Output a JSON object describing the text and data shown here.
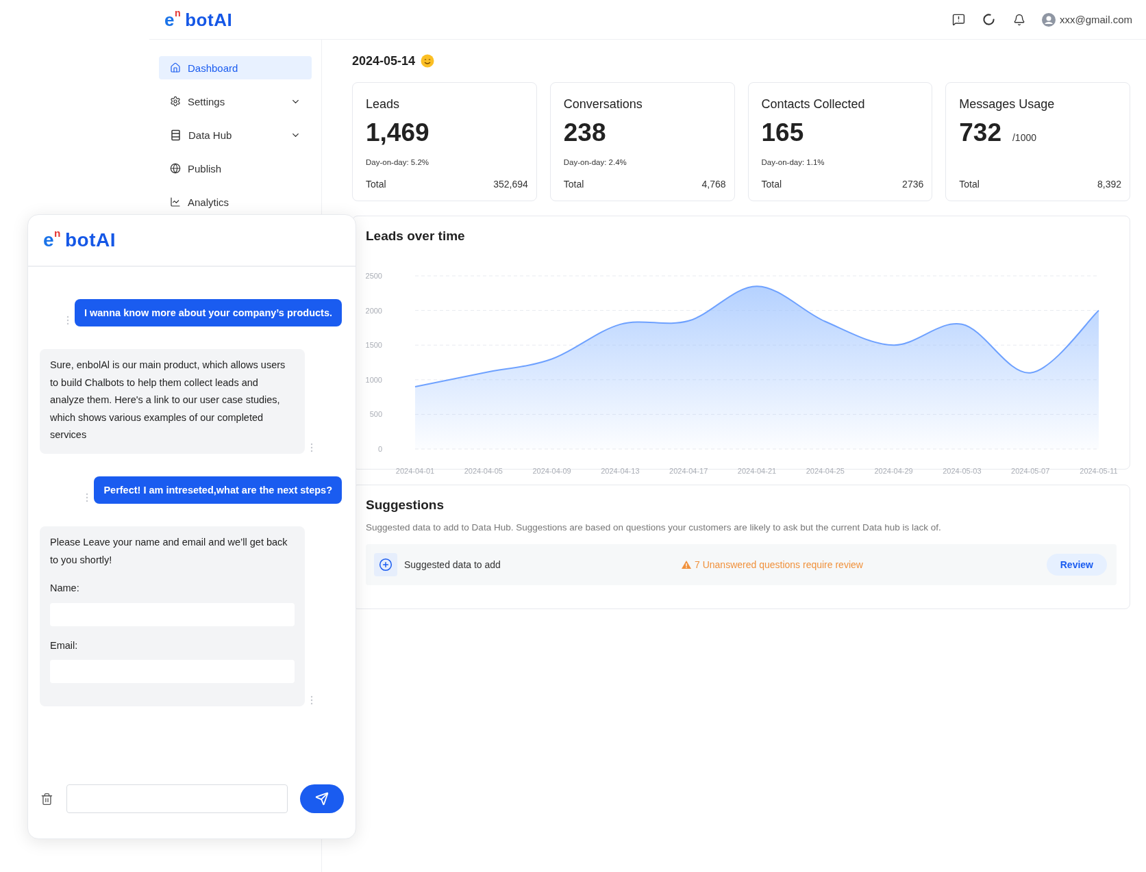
{
  "header": {
    "logo": {
      "mark": "e",
      "sup": "n",
      "word": "botAI"
    },
    "user_email": "xxx@gmail.com"
  },
  "sidebar": {
    "items": [
      {
        "label": "Dashboard",
        "selected": true,
        "kind": "link"
      },
      {
        "label": "Settings",
        "selected": false,
        "kind": "menu",
        "expanded": false
      },
      {
        "label": "Data Hub",
        "selected": false,
        "kind": "menu",
        "expanded": false
      },
      {
        "label": "Publish",
        "selected": false,
        "kind": "link"
      },
      {
        "label": "Analytics",
        "selected": false,
        "kind": "link"
      }
    ]
  },
  "date": "2024-05-14",
  "stats": [
    {
      "title": "Leads",
      "value": "1,469",
      "change": "Day-on-day: 5.2%",
      "total_label": "Total",
      "total": "352,694"
    },
    {
      "title": "Conversations",
      "value": "238",
      "change": "Day-on-day: 2.4%",
      "total_label": "Total",
      "total": "4,768"
    },
    {
      "title": "Contacts Collected",
      "value": "165",
      "change": "Day-on-day: 1.1%",
      "total_label": "Total",
      "total": "2736"
    },
    {
      "title": "Messages Usage",
      "value": "732",
      "limit": "/1000",
      "total_label": "Total",
      "total": "8,392"
    }
  ],
  "leads_chart": {
    "title": "Leads over time",
    "chart_data": {
      "type": "area",
      "categories": [
        "2024-04-01",
        "2024-04-05",
        "2024-04-09",
        "2024-04-13",
        "2024-04-17",
        "2024-04-21",
        "2024-04-25",
        "2024-04-29",
        "2024-05-03",
        "2024-05-07",
        "2024-05-11"
      ],
      "series": [
        {
          "color": "#6ea1ff",
          "values": [
            900,
            1100,
            1300,
            1800,
            1850,
            2350,
            1840,
            1500,
            1800,
            1100,
            2000
          ]
        }
      ],
      "ylim": [
        0,
        2500
      ],
      "yticks": [
        0,
        500,
        1000,
        1500,
        2000,
        2500
      ],
      "grid": true
    }
  },
  "suggestions": {
    "title": "Suggestions",
    "description": "Suggested data to add to Data Hub. Suggestions are based on questions  your customers are likely to ask but the current Data hub is lack of.",
    "row": {
      "label": "Suggested data to add",
      "warning": "7 Unanswered questions require review",
      "action": "Review"
    }
  },
  "chat": {
    "logo": {
      "mark": "e",
      "sup": "n",
      "word": "botAI"
    },
    "messages": [
      {
        "kind": "user",
        "text": "I wanna know more about your company’s products."
      },
      {
        "kind": "bot",
        "text": "Sure, enbolAl is our main product, which allows users to build Chalbots to help them collect leads and analyze them. Here's a link to our user case studies, which shows various examples of our completed services"
      },
      {
        "kind": "user",
        "text": "Perfect! I am intreseted,what are the next steps?"
      },
      {
        "kind": "form",
        "text": "Please Leave your name and email and we’ll get back to you shortly!",
        "fields": [
          {
            "label": "Name:"
          },
          {
            "label": "Email:"
          }
        ]
      }
    ]
  }
}
